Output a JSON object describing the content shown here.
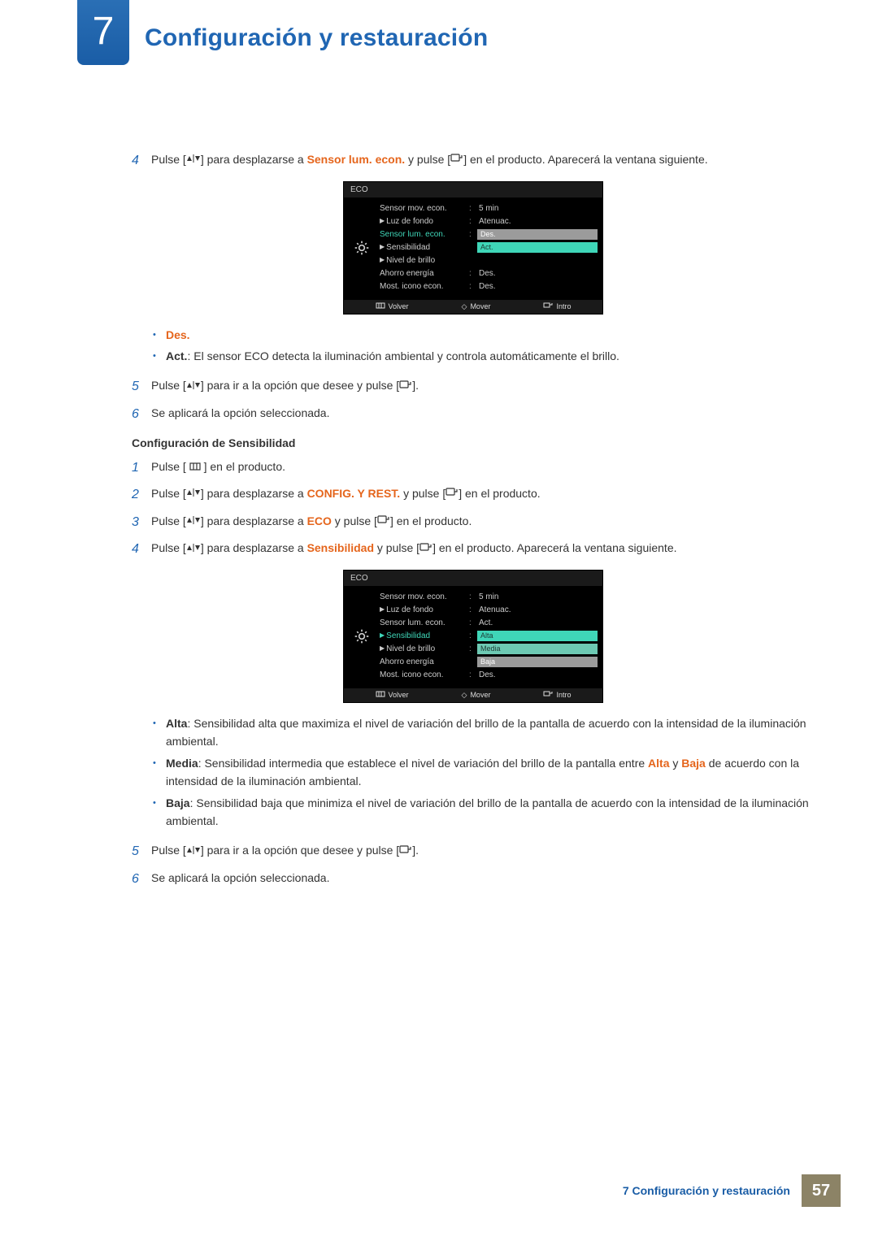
{
  "chapter": {
    "number": "7",
    "title": "Configuración y restauración"
  },
  "upper_steps": {
    "s4": {
      "num": "4",
      "pre": "Pulse [",
      "mid1": "] para desplazarse a ",
      "hl": "Sensor lum. econ.",
      "mid2": " y pulse [",
      "post": "] en el producto. Aparecerá la ventana siguiente."
    },
    "s5": {
      "num": "5",
      "pre": "Pulse [",
      "mid": "] para ir a la opción que desee y pulse [",
      "post": "]."
    },
    "s6": {
      "num": "6",
      "text": "Se aplicará la opción seleccionada."
    }
  },
  "osd1": {
    "title": "ECO",
    "rows": {
      "r1": {
        "label": "Sensor mov. econ.",
        "val": "5 min"
      },
      "r2": {
        "label": "Luz de fondo",
        "val": "Atenuac."
      },
      "r3": {
        "label": "Sensor lum. econ.",
        "opt1": "Des.",
        "opt2": "Act."
      },
      "r4": {
        "label": "Sensibilidad"
      },
      "r5": {
        "label": "Nivel de brillo"
      },
      "r6": {
        "label": "Ahorro energía",
        "val": "Des."
      },
      "r7": {
        "label": "Most. icono econ.",
        "val": "Des."
      }
    },
    "foot": {
      "f1": "Volver",
      "f2": "Mover",
      "f3": "Intro"
    }
  },
  "mid_bullets": {
    "b1": "Des.",
    "b2_bold": "Act.",
    "b2_text": ": El sensor ECO detecta la iluminación ambiental y controla automáticamente el brillo."
  },
  "sens": {
    "heading": "Configuración de Sensibilidad",
    "s1": {
      "num": "1",
      "pre": "Pulse [ ",
      "post": " ] en el producto."
    },
    "s2": {
      "num": "2",
      "pre": "Pulse [",
      "mid1": "] para desplazarse a ",
      "hl": "CONFIG. Y REST.",
      "mid2": " y pulse [",
      "post": "] en el producto."
    },
    "s3": {
      "num": "3",
      "pre": "Pulse [",
      "mid1": "] para desplazarse a ",
      "hl": "ECO",
      "mid2": " y pulse [",
      "post": "] en el producto."
    },
    "s4": {
      "num": "4",
      "pre": "Pulse [",
      "mid1": "] para desplazarse a ",
      "hl": "Sensibilidad",
      "mid2": " y pulse [",
      "post": "] en el producto. Aparecerá la ventana siguiente."
    },
    "s5": {
      "num": "5",
      "pre": "Pulse [",
      "mid": "] para ir a la opción que desee y pulse [",
      "post": "]."
    },
    "s6": {
      "num": "6",
      "text": "Se aplicará la opción seleccionada."
    }
  },
  "osd2": {
    "title": "ECO",
    "rows": {
      "r1": {
        "label": "Sensor mov. econ.",
        "val": "5 min"
      },
      "r2": {
        "label": "Luz de fondo",
        "val": "Atenuac."
      },
      "r3": {
        "label": "Sensor lum. econ.",
        "val": "Act."
      },
      "r4": {
        "label": "Sensibilidad",
        "opt1": "Alta",
        "opt2": "Media",
        "opt3": "Baja"
      },
      "r5": {
        "label": "Nivel de brillo"
      },
      "r6": {
        "label": "Ahorro energía"
      },
      "r7": {
        "label": "Most. icono econ.",
        "val": "Des."
      }
    },
    "foot": {
      "f1": "Volver",
      "f2": "Mover",
      "f3": "Intro"
    }
  },
  "lower_bullets": {
    "b1_bold": "Alta",
    "b1_text": ": Sensibilidad alta que maximiza el nivel de variación del brillo de la pantalla de acuerdo con la intensidad de la iluminación ambiental.",
    "b2_bold": "Media",
    "b2_pre": ": Sensibilidad intermedia que establece el nivel de variación del brillo de la pantalla entre ",
    "b2_hl1": "Alta",
    "b2_mid": " y ",
    "b2_hl2": "Baja",
    "b2_post": " de acuerdo con la intensidad de la iluminación ambiental.",
    "b3_bold": "Baja",
    "b3_text": ": Sensibilidad baja que minimiza el nivel de variación del brillo de la pantalla de acuerdo con la intensidad de la iluminación ambiental."
  },
  "footer": {
    "label": "7 Configuración y restauración",
    "page": "57"
  }
}
